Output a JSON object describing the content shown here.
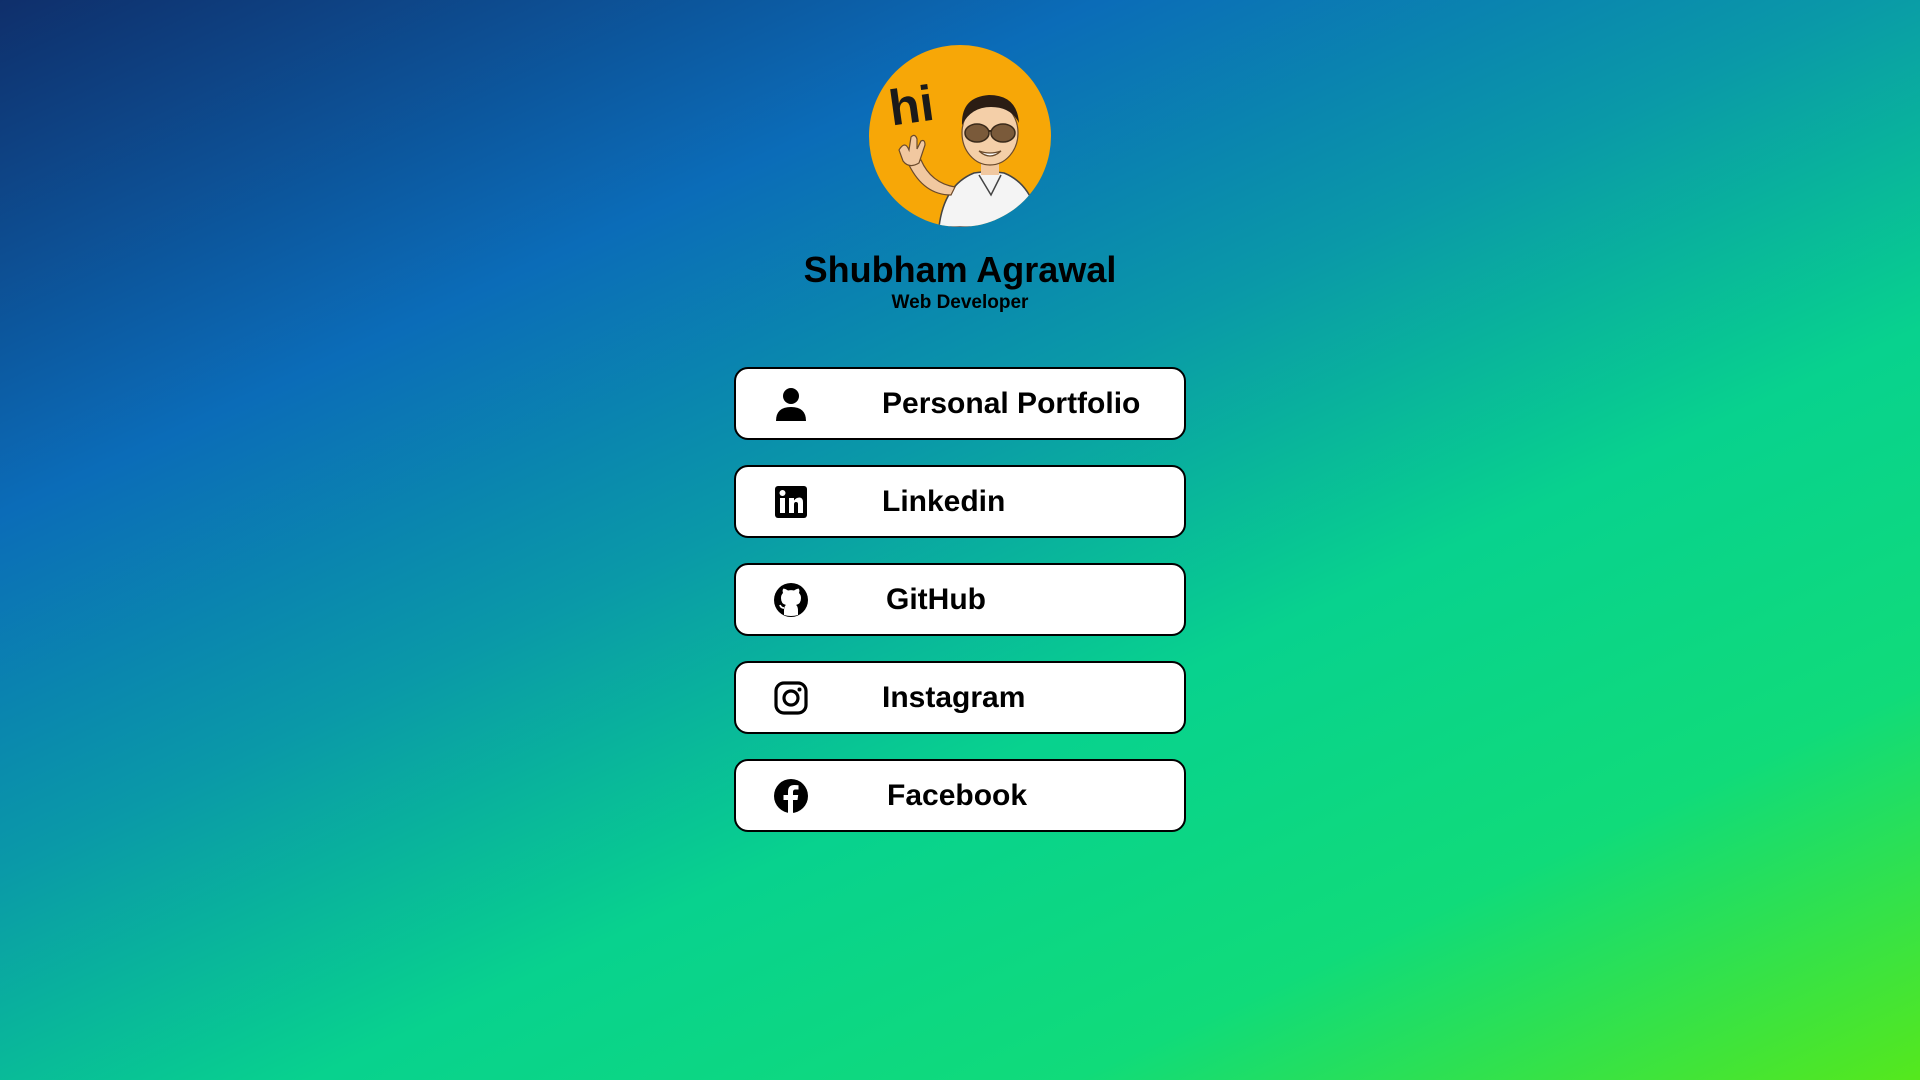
{
  "profile": {
    "avatar_greeting": "hi",
    "name": "Shubham Agrawal",
    "role": "Web Developer"
  },
  "links": [
    {
      "label": "Personal Portfolio",
      "icon": "person-icon"
    },
    {
      "label": "Linkedin",
      "icon": "linkedin-icon"
    },
    {
      "label": "GitHub",
      "icon": "github-icon"
    },
    {
      "label": "Instagram",
      "icon": "instagram-icon"
    },
    {
      "label": "Facebook",
      "icon": "facebook-icon"
    }
  ],
  "colors": {
    "avatar_background": "#f7a707",
    "button_background": "#ffffff",
    "button_border": "#000000",
    "text": "#000000"
  }
}
